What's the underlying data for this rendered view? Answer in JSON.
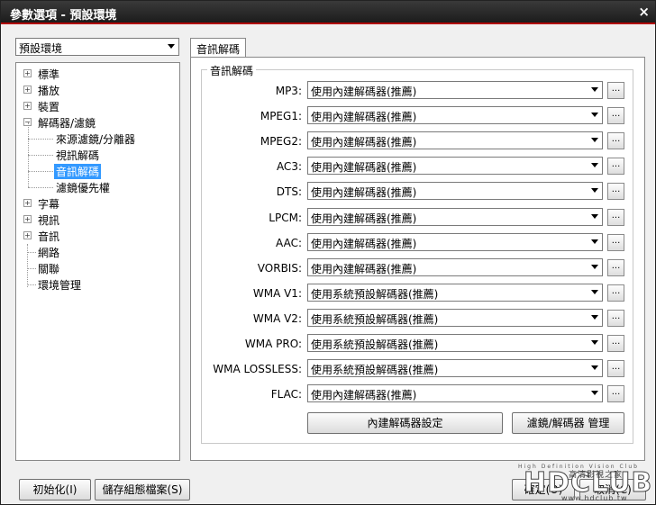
{
  "window": {
    "title": "參數選項 - 預設環境",
    "close_glyph": "×"
  },
  "profile_combo": {
    "value": "預設環境"
  },
  "tree": {
    "items": [
      {
        "label": "標準",
        "expander": "+"
      },
      {
        "label": "播放",
        "expander": "+"
      },
      {
        "label": "裝置",
        "expander": "+"
      },
      {
        "label": "解碼器/濾鏡",
        "expander": "−"
      },
      {
        "label": "來源濾鏡/分離器"
      },
      {
        "label": "視訊解碼"
      },
      {
        "label": "音訊解碼"
      },
      {
        "label": "濾鏡優先權"
      },
      {
        "label": "字幕",
        "expander": "+"
      },
      {
        "label": "視訊",
        "expander": "+"
      },
      {
        "label": "音訊",
        "expander": "+"
      },
      {
        "label": "網路"
      },
      {
        "label": "關聯"
      },
      {
        "label": "環境管理"
      }
    ],
    "selected": "音訊解碼"
  },
  "tab": {
    "label": "音訊解碼"
  },
  "group": {
    "title": "音訊解碼"
  },
  "codecs": [
    {
      "label": "MP3:",
      "value": "使用內建解碼器(推薦)"
    },
    {
      "label": "MPEG1:",
      "value": "使用內建解碼器(推薦)"
    },
    {
      "label": "MPEG2:",
      "value": "使用內建解碼器(推薦)"
    },
    {
      "label": "AC3:",
      "value": "使用內建解碼器(推薦)"
    },
    {
      "label": "DTS:",
      "value": "使用內建解碼器(推薦)"
    },
    {
      "label": "LPCM:",
      "value": "使用內建解碼器(推薦)"
    },
    {
      "label": "AAC:",
      "value": "使用內建解碼器(推薦)"
    },
    {
      "label": "VORBIS:",
      "value": "使用內建解碼器(推薦)"
    },
    {
      "label": "WMA V1:",
      "value": "使用系統預設解碼器(推薦)"
    },
    {
      "label": "WMA V2:",
      "value": "使用系統預設解碼器(推薦)"
    },
    {
      "label": "WMA PRO:",
      "value": "使用系統預設解碼器(推薦)"
    },
    {
      "label": "WMA LOSSLESS:",
      "value": "使用系統預設解碼器(推薦)"
    },
    {
      "label": "FLAC:",
      "value": "使用內建解碼器(推薦)"
    }
  ],
  "ellipsis_label": "...",
  "buttons": {
    "builtin_settings": "內建解碼器設定",
    "filter_manager": "濾鏡/解碼器 管理",
    "initialize": "初始化(I)",
    "save_profile": "儲存組態檔案(S)",
    "ok_partial": "確定(O)",
    "cancel_partial": "取消(C)"
  },
  "watermark": {
    "tagline": "High Definition Vision Club",
    "brand": "HDCLUB",
    "chinese": "高清影視之家",
    "url": "www.hdclub.tw"
  },
  "colors": {
    "selection": "#3399ff",
    "title_accent": "#b00000"
  }
}
